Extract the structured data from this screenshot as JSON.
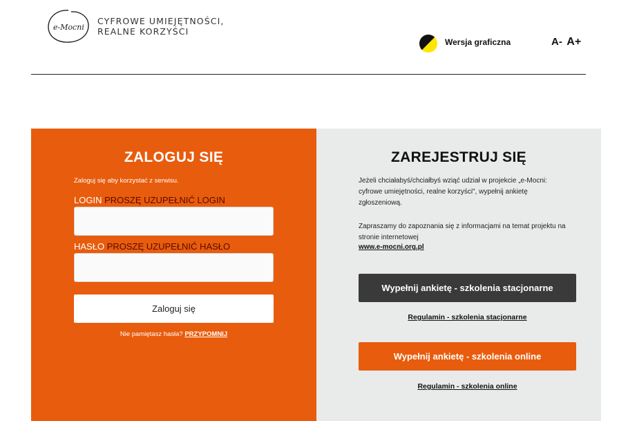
{
  "header": {
    "logo_text": "e-Mocni",
    "tagline_line1": "CYFROWE UMIEJĘTNOŚCI,",
    "tagline_line2": "REALNE KORZYŚCI",
    "contrast_label": "Wersja graficzna",
    "font_decrease": "A-",
    "font_increase": "A+"
  },
  "login": {
    "title": "ZALOGUJ SIĘ",
    "subtitle": "Zaloguj się aby korzystać z serwisu.",
    "login_label": "LOGIN",
    "login_error": "PROSZĘ UZUPEŁNIĆ LOGIN",
    "login_value": "",
    "password_label": "HASŁO",
    "password_error": "PROSZĘ UZUPEŁNIĆ HASŁO",
    "password_value": "",
    "submit_label": "Zaloguj się",
    "forgot_text": "Nie pamiętasz hasła?",
    "forgot_link": "PRZYPOMNIJ"
  },
  "register": {
    "title": "ZAREJESTRUJ SIĘ",
    "paragraph1": "Jeżeli chciałabyś/chciałbyś wziąć udział w projekcie „e-Mocni: cyfrowe umiejętności, realne korzyści\", wypełnij ankietę zgłoszeniową.",
    "paragraph2": "Zapraszamy do zapoznania się z informacjami na temat projektu na stronie internetowej",
    "website_link": "www.e-mocni.org.pl",
    "btn_stationary": "Wypełnij ankietę - szkolenia stacjonarne",
    "rules_stationary": "Regulamin - szkolenia stacjonarne",
    "btn_online": "Wypełnij ankietę - szkolenia online",
    "rules_online": "Regulamin - szkolenia online"
  },
  "colors": {
    "accent_orange": "#e85c0d",
    "dark_button": "#3a3a3a",
    "panel_gray": "#e9eaea",
    "contrast_yellow": "#ffe600"
  },
  "icons": {
    "logo": "e-mocni-logo-icon",
    "contrast": "contrast-toggle-icon"
  }
}
